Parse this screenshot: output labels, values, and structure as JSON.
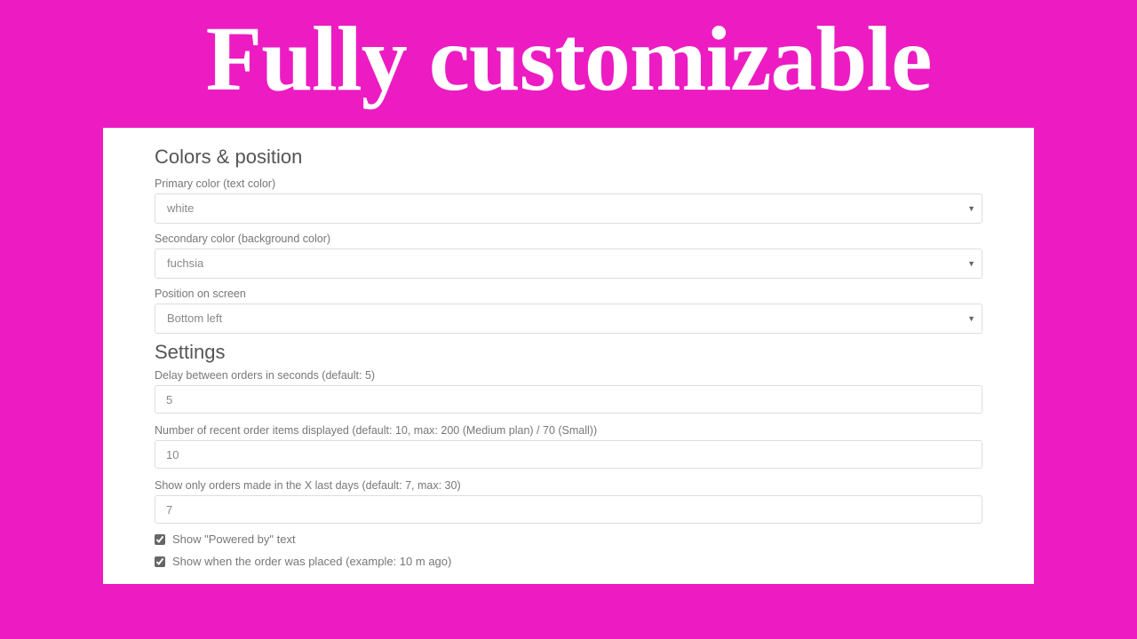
{
  "hero": {
    "title": "Fully customizable"
  },
  "sections": {
    "colors": {
      "title": "Colors & position",
      "primary": {
        "label": "Primary color (text color)",
        "value": "white"
      },
      "secondary": {
        "label": "Secondary color (background color)",
        "value": "fuchsia"
      },
      "position": {
        "label": "Position on screen",
        "value": "Bottom left"
      }
    },
    "settings": {
      "title": "Settings",
      "delay": {
        "label": "Delay between orders in seconds (default: 5)",
        "value": "5"
      },
      "recent": {
        "label": "Number of recent order items displayed (default: 10, max: 200 (Medium plan) / 70 (Small))",
        "value": "10"
      },
      "days": {
        "label": "Show only orders made in the X last days (default: 7, max: 30)",
        "value": "7"
      },
      "poweredBy": {
        "label": "Show \"Powered by\" text",
        "checked": true
      },
      "showWhen": {
        "label": "Show when the order was placed (example: 10 m ago)",
        "checked": true
      }
    }
  }
}
